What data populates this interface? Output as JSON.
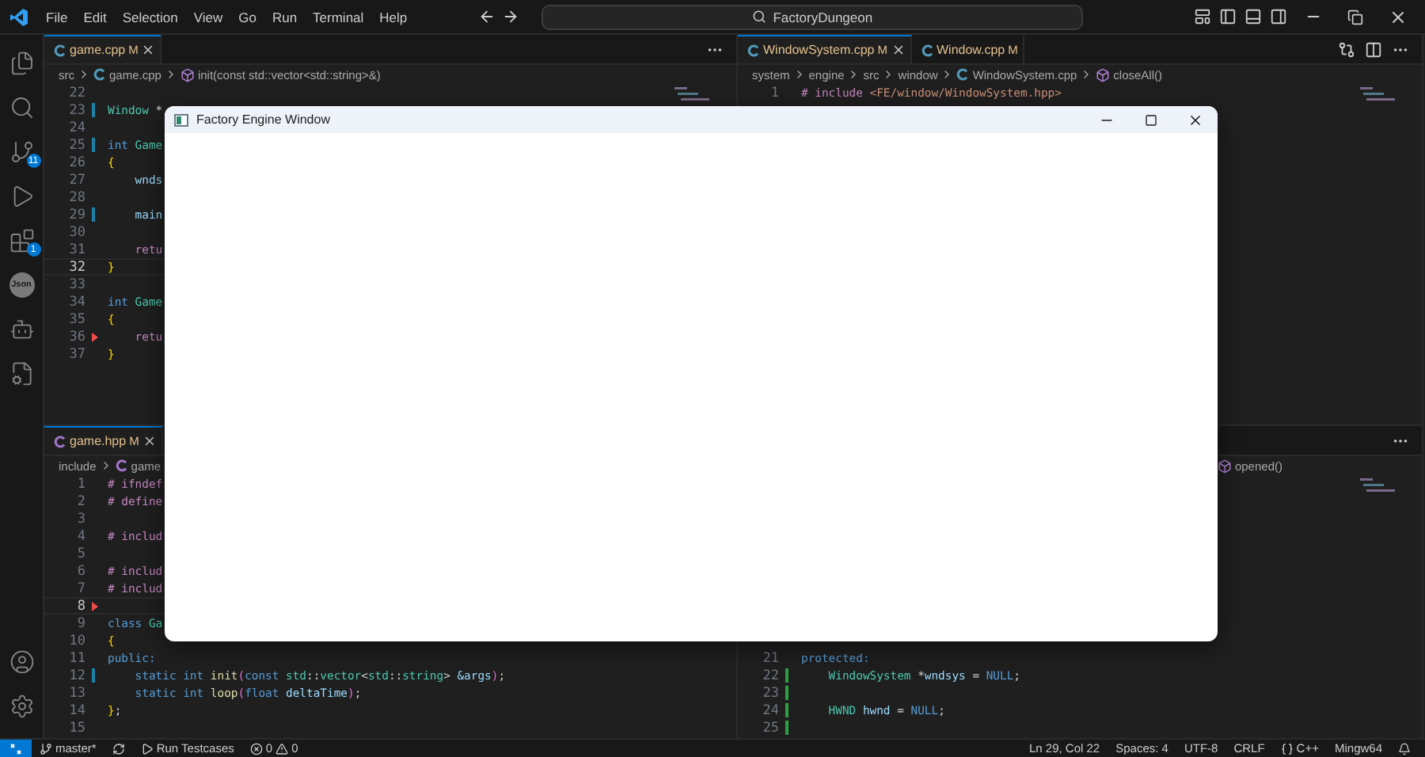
{
  "title_bar": {
    "menus": [
      "File",
      "Edit",
      "Selection",
      "View",
      "Go",
      "Run",
      "Terminal",
      "Help"
    ],
    "search": "FactoryDungeon"
  },
  "activity_bar": {
    "top": [
      {
        "kind": "files"
      },
      {
        "kind": "search"
      },
      {
        "kind": "source-control",
        "badge": "11"
      },
      {
        "kind": "run-debug"
      },
      {
        "kind": "extensions",
        "badge": "1"
      },
      {
        "kind": "json",
        "text": "Json"
      },
      {
        "kind": "alien"
      },
      {
        "kind": "test-report"
      }
    ],
    "bottom": [
      {
        "kind": "account"
      },
      {
        "kind": "settings"
      }
    ]
  },
  "editor_groups": [
    {
      "panes": [
        {
          "tabs": [
            {
              "label": "game.cpp",
              "status": "M",
              "kind": "cpp",
              "selected": true
            }
          ],
          "actions": [
            {
              "kind": "more"
            }
          ],
          "breadcrumbs": [
            {
              "text": "src",
              "kind": "folder"
            },
            {
              "text": "game.cpp",
              "kind": "cpp"
            },
            {
              "text": "init(const std::vector<std::string>&)",
              "kind": "method"
            }
          ],
          "lines": [
            {
              "number": "22"
            },
            {
              "number": "23",
              "modified": true,
              "tokens": [
                {
                  "text": "Window",
                  "kind": "type"
                },
                {
                  "text": " *",
                  "kind": "plain"
                }
              ]
            },
            {
              "number": "24"
            },
            {
              "number": "25",
              "modified": true,
              "tokens": [
                {
                  "text": "int",
                  "kind": "keyword"
                },
                {
                  "text": " Game",
                  "kind": "type"
                }
              ]
            },
            {
              "number": "26",
              "tokens": [
                {
                  "text": "{",
                  "kind": "brace"
                }
              ]
            },
            {
              "number": "27",
              "tokens": [
                {
                  "text": "    wnds",
                  "kind": "var"
                }
              ]
            },
            {
              "number": "28"
            },
            {
              "number": "29",
              "modified": true,
              "tokens": [
                {
                  "text": "    main",
                  "kind": "var"
                }
              ]
            },
            {
              "number": "30"
            },
            {
              "number": "31",
              "tokens": [
                {
                  "text": "    retu",
                  "kind": "control"
                }
              ]
            },
            {
              "number": "32",
              "current": true,
              "tokens": [
                {
                  "text": "}",
                  "kind": "brace"
                }
              ]
            },
            {
              "number": "33"
            },
            {
              "number": "34",
              "tokens": [
                {
                  "text": "int",
                  "kind": "keyword"
                },
                {
                  "text": " Game",
                  "kind": "type"
                }
              ]
            },
            {
              "number": "35",
              "tokens": [
                {
                  "text": "{",
                  "kind": "brace"
                }
              ]
            },
            {
              "number": "36",
              "deleted": true,
              "tokens": [
                {
                  "text": "    retu",
                  "kind": "control"
                }
              ]
            },
            {
              "number": "37",
              "tokens": [
                {
                  "text": "}",
                  "kind": "brace"
                }
              ]
            }
          ]
        },
        {
          "tabs": [
            {
              "label": "game.hpp",
              "status": "M",
              "kind": "hpp",
              "selected": true
            }
          ],
          "breadcrumbs": [
            {
              "text": "include",
              "kind": "folder"
            },
            {
              "text": "game",
              "kind": "hpp"
            }
          ],
          "lines": [
            {
              "number": "1",
              "tokens": [
                {
                  "text": "# ifndef",
                  "kind": "preproc"
                }
              ]
            },
            {
              "number": "2",
              "tokens": [
                {
                  "text": "# define",
                  "kind": "preproc"
                }
              ]
            },
            {
              "number": "3"
            },
            {
              "number": "4",
              "tokens": [
                {
                  "text": "# includ",
                  "kind": "preproc"
                }
              ]
            },
            {
              "number": "5"
            },
            {
              "number": "6",
              "tokens": [
                {
                  "text": "# includ",
                  "kind": "preproc"
                }
              ]
            },
            {
              "number": "7",
              "tokens": [
                {
                  "text": "# includ",
                  "kind": "preproc"
                }
              ]
            },
            {
              "number": "8",
              "current": true,
              "deleted": true
            },
            {
              "number": "9",
              "tokens": [
                {
                  "text": "class",
                  "kind": "keyword"
                },
                {
                  "text": " Ga",
                  "kind": "type"
                }
              ]
            },
            {
              "number": "10",
              "tokens": [
                {
                  "text": "{",
                  "kind": "brace"
                }
              ]
            },
            {
              "number": "11",
              "tokens": [
                {
                  "text": "public:",
                  "kind": "keyword"
                }
              ]
            },
            {
              "number": "12",
              "modified": true,
              "tokens": [
                {
                  "text": "    static int ",
                  "kind": "keyword"
                },
                {
                  "text": "init",
                  "kind": "func"
                },
                {
                  "text": "(",
                  "kind": "paren"
                },
                {
                  "text": "const ",
                  "kind": "keyword"
                },
                {
                  "text": "std",
                  "kind": "type"
                },
                {
                  "text": "::",
                  "kind": "plain"
                },
                {
                  "text": "vector",
                  "kind": "type"
                },
                {
                  "text": "<",
                  "kind": "plain"
                },
                {
                  "text": "std",
                  "kind": "type"
                },
                {
                  "text": "::",
                  "kind": "plain"
                },
                {
                  "text": "string",
                  "kind": "type"
                },
                {
                  "text": "> ",
                  "kind": "plain"
                },
                {
                  "text": "&args",
                  "kind": "var"
                },
                {
                  "text": ")",
                  "kind": "paren"
                },
                {
                  "text": ";",
                  "kind": "plain"
                }
              ]
            },
            {
              "number": "13",
              "tokens": [
                {
                  "text": "    static int ",
                  "kind": "keyword"
                },
                {
                  "text": "loop",
                  "kind": "func"
                },
                {
                  "text": "(",
                  "kind": "paren"
                },
                {
                  "text": "float ",
                  "kind": "keyword"
                },
                {
                  "text": "deltaTime",
                  "kind": "var"
                },
                {
                  "text": ")",
                  "kind": "paren"
                },
                {
                  "text": ";",
                  "kind": "plain"
                }
              ]
            },
            {
              "number": "14",
              "tokens": [
                {
                  "text": "}",
                  "kind": "brace"
                },
                {
                  "text": ";",
                  "kind": "plain"
                }
              ]
            },
            {
              "number": "15"
            }
          ]
        }
      ]
    },
    {
      "panes": [
        {
          "tabs": [
            {
              "label": "WindowSystem.cpp",
              "status": "M",
              "kind": "cpp",
              "selected": true
            },
            {
              "label": "Window.cpp",
              "status": "M",
              "kind": "cpp",
              "selected": false
            }
          ],
          "actions": [
            {
              "kind": "compare"
            },
            {
              "kind": "split"
            },
            {
              "kind": "more"
            }
          ],
          "breadcrumbs": [
            {
              "text": "system",
              "kind": "folder"
            },
            {
              "text": "engine",
              "kind": "folder"
            },
            {
              "text": "src",
              "kind": "folder"
            },
            {
              "text": "window",
              "kind": "folder"
            },
            {
              "text": "WindowSystem.cpp",
              "kind": "cpp"
            },
            {
              "text": "closeAll()",
              "kind": "method"
            }
          ],
          "lines": [
            {
              "number": "1",
              "tokens": [
                {
                  "text": "# include",
                  "kind": "preproc"
                },
                {
                  "text": " <FE/window/WindowSystem.hpp>",
                  "kind": "string"
                }
              ]
            }
          ]
        },
        {
          "actions": [
            {
              "kind": "more"
            }
          ],
          "breadcrumbs": [
            {
              "text": "opened()",
              "kind": "method"
            }
          ],
          "lines": [
            {
              "number": "21",
              "tokens": [
                {
                  "text": "protected:",
                  "kind": "keyword"
                }
              ]
            },
            {
              "number": "22",
              "added": true,
              "tokens": [
                {
                  "text": "    WindowSystem",
                  "kind": "type"
                },
                {
                  "text": " *",
                  "kind": "plain"
                },
                {
                  "text": "wndsys",
                  "kind": "var"
                },
                {
                  "text": " = ",
                  "kind": "plain"
                },
                {
                  "text": "NULL",
                  "kind": "keyword"
                },
                {
                  "text": ";",
                  "kind": "plain"
                }
              ]
            },
            {
              "number": "23",
              "added": true
            },
            {
              "number": "24",
              "added": true,
              "tokens": [
                {
                  "text": "    HWND",
                  "kind": "type"
                },
                {
                  "text": " hwnd",
                  "kind": "var"
                },
                {
                  "text": " = ",
                  "kind": "plain"
                },
                {
                  "text": "NULL",
                  "kind": "keyword"
                },
                {
                  "text": ";",
                  "kind": "plain"
                }
              ]
            },
            {
              "number": "25",
              "added": true
            }
          ]
        }
      ]
    }
  ],
  "floating_window": {
    "title": "Factory Engine Window"
  },
  "status_bar": {
    "left": [
      {
        "kind": "remote"
      },
      {
        "kind": "branch",
        "text": "master*"
      },
      {
        "kind": "sync"
      },
      {
        "kind": "run",
        "text": "Run Testcases"
      },
      {
        "kind": "problems",
        "errors": "0",
        "warnings": "0"
      }
    ],
    "right": [
      {
        "kind": "text",
        "text": "Ln 29, Col 22"
      },
      {
        "kind": "text",
        "text": "Spaces: 4"
      },
      {
        "kind": "text",
        "text": "UTF-8"
      },
      {
        "kind": "text",
        "text": "CRLF"
      },
      {
        "kind": "language",
        "text": "C++"
      },
      {
        "kind": "text",
        "text": "Mingw64"
      },
      {
        "kind": "bell"
      }
    ]
  }
}
